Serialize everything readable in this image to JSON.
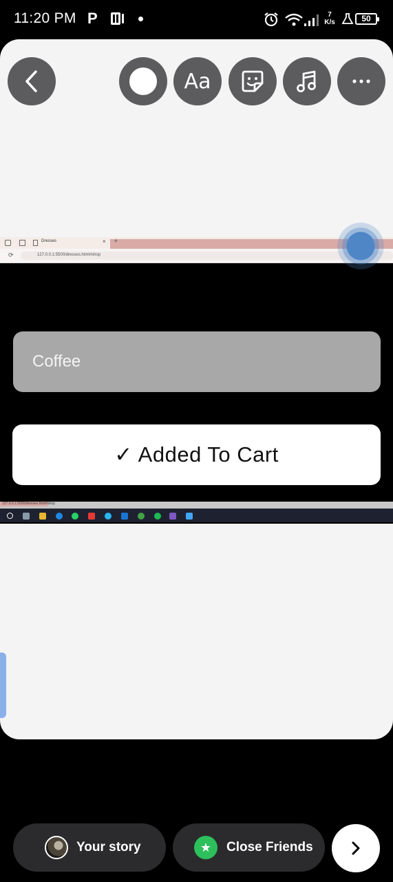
{
  "status_bar": {
    "time": "11:20 PM",
    "carrier_icon_letter": "P",
    "network_speed_value": "7",
    "network_speed_unit": "K/s",
    "battery_level": "50"
  },
  "toolbar": {
    "back_icon": "chevron-left-icon",
    "circle_icon": "draw-circle-icon",
    "text_label": "Aa",
    "sticker_icon": "sticker-icon",
    "music_icon": "music-note-icon",
    "more_icon": "more-horizontal-icon"
  },
  "shared_screenshot": {
    "browser_tab_title": "Dresses",
    "address_bar_url": "127.0.0.1:5500/dresses.html#shop",
    "coffee_field_text": "Coffee",
    "added_button_check": "✓",
    "added_button_label": "Added To Cart",
    "taskbar_url": "127.0.0.1:5500/dresses.html#shop"
  },
  "share_bar": {
    "your_story_label": "Your story",
    "close_friends_label": "Close Friends",
    "next_icon": "chevron-right-icon"
  },
  "colors": {
    "canvas_bg": "#f4f4f4",
    "tool_button_bg": "#5c5c5e",
    "close_friends_green": "#2dbf5b",
    "pill_bg": "#2b2b2d",
    "touch_indicator": "#4f86c6"
  }
}
